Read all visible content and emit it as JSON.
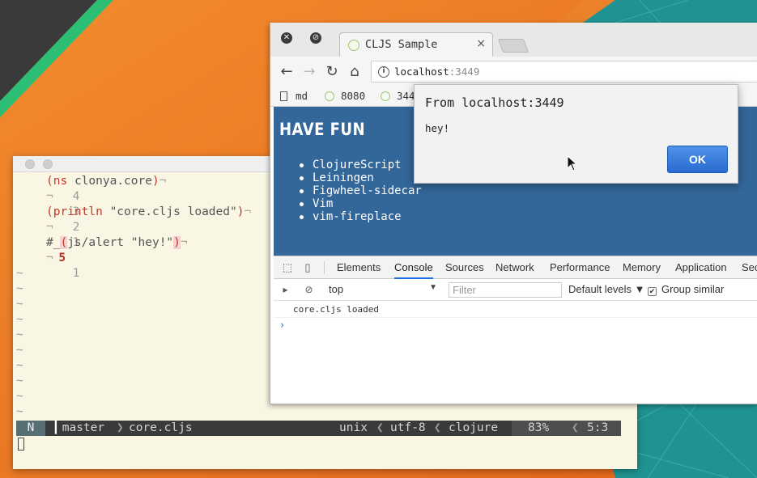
{
  "vim": {
    "lines": [
      {
        "num": "4",
        "code": "(ns clonya.core)"
      },
      {
        "num": "3",
        "code": ""
      },
      {
        "num": "2",
        "code": "(println \"core.cljs loaded\")"
      },
      {
        "num": "1",
        "code": ""
      },
      {
        "num": "5",
        "code": "#_(js/alert \"hey!\")"
      },
      {
        "num": "1",
        "code": ""
      }
    ],
    "eol_char": "¬",
    "tilde": "~",
    "status": {
      "mode": "N",
      "branch": "master",
      "file": "core.cljs",
      "fileformat": "unix",
      "encoding": "utf-8",
      "filetype": "clojure",
      "percent": "83%",
      "position": "5:3"
    }
  },
  "browser": {
    "tab_title": "CLJS Sample",
    "tab_close": "×",
    "url_host": "localhost",
    "url_port": ":3449",
    "bookmarks": [
      "md",
      "8080",
      "344"
    ],
    "page": {
      "heading": "HAVE FUN",
      "items": [
        "ClojureScript",
        "Leiningen",
        "Figwheel-sidecar",
        "Vim",
        "vim-fireplace"
      ],
      "bg_color": "#336699"
    },
    "devtools": {
      "tabs": [
        "Elements",
        "Console",
        "Sources",
        "Network",
        "Performance",
        "Memory",
        "Application",
        "Sec"
      ],
      "active_tab": "Console",
      "context": "top",
      "filter_placeholder": "Filter",
      "levels_label": "Default levels ▼",
      "group_similar_label": "Group similar",
      "messages": [
        "core.cljs loaded"
      ],
      "prompt": "›"
    }
  },
  "alert": {
    "title": "From localhost:3449",
    "message": "hey!",
    "ok_label": "OK"
  }
}
